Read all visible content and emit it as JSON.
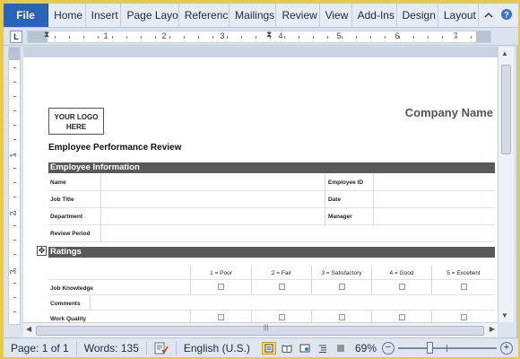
{
  "ribbon": {
    "file_tab": "File",
    "tabs": [
      "Home",
      "Insert",
      "Page Layo",
      "Referenc",
      "Mailings",
      "Review",
      "View",
      "Add-Ins",
      "Design",
      "Layout"
    ],
    "minimize_icon": "chevron-up-icon",
    "help_icon": "help-icon"
  },
  "ruler": {
    "tab_selector": "L",
    "h_numbers": [
      "1",
      "2",
      "3",
      "4",
      "5",
      "6",
      "7"
    ],
    "v_numbers": [
      "1",
      "2",
      "3"
    ]
  },
  "document": {
    "logo_line1": "YOUR LOGO",
    "logo_line2": "HERE",
    "company_name": "Company Name",
    "title": "Employee Performance Review",
    "employee_info_header": "Employee Information",
    "info_rows": [
      {
        "label": "Name",
        "label2": "Employee  ID"
      },
      {
        "label": "Job Title",
        "label2": "Date"
      },
      {
        "label": "Department",
        "label2": "Manager"
      },
      {
        "label": "Review Period",
        "label2": ""
      }
    ],
    "ratings_header": "Ratings",
    "rating_scale": [
      "1 = Poor",
      "2 = Fair",
      "3 = Satisfactory",
      "4 = Good",
      "5 = Excellent"
    ],
    "rating_rows": [
      {
        "label": "Job Knowledge",
        "has_boxes": true
      },
      {
        "label": "Comments",
        "has_boxes": false
      },
      {
        "label": "Work Quality",
        "has_boxes": true
      }
    ],
    "table_move_icon": "move-handle-icon"
  },
  "status_bar": {
    "page": "Page: 1 of 1",
    "words": "Words: 135",
    "proofing_icon": "proofing-icon",
    "language": "English (U.S.)",
    "zoom": "69%",
    "zoom_out": "−",
    "zoom_in": "+",
    "zoom_level": 0.69,
    "view_buttons": [
      "print-layout-icon",
      "full-screen-reading-icon",
      "web-layout-icon",
      "outline-icon",
      "draft-icon"
    ]
  },
  "colors": {
    "file_tab": "#2a64b8",
    "section_bar": "#595959",
    "window_border": "#e8c94a"
  }
}
